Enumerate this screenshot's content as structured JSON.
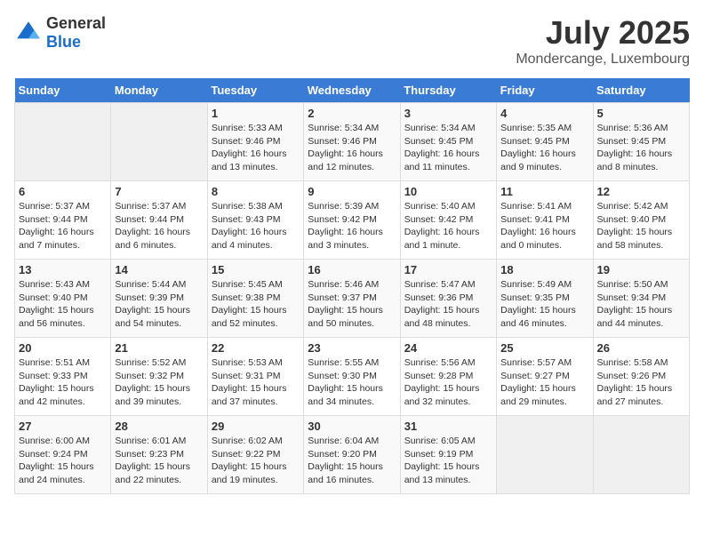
{
  "header": {
    "logo_general": "General",
    "logo_blue": "Blue",
    "month": "July 2025",
    "location": "Mondercange, Luxembourg"
  },
  "days_of_week": [
    "Sunday",
    "Monday",
    "Tuesday",
    "Wednesday",
    "Thursday",
    "Friday",
    "Saturday"
  ],
  "weeks": [
    [
      {
        "day": "",
        "empty": true
      },
      {
        "day": "",
        "empty": true
      },
      {
        "day": "1",
        "sunrise": "Sunrise: 5:33 AM",
        "sunset": "Sunset: 9:46 PM",
        "daylight": "Daylight: 16 hours and 13 minutes."
      },
      {
        "day": "2",
        "sunrise": "Sunrise: 5:34 AM",
        "sunset": "Sunset: 9:46 PM",
        "daylight": "Daylight: 16 hours and 12 minutes."
      },
      {
        "day": "3",
        "sunrise": "Sunrise: 5:34 AM",
        "sunset": "Sunset: 9:45 PM",
        "daylight": "Daylight: 16 hours and 11 minutes."
      },
      {
        "day": "4",
        "sunrise": "Sunrise: 5:35 AM",
        "sunset": "Sunset: 9:45 PM",
        "daylight": "Daylight: 16 hours and 9 minutes."
      },
      {
        "day": "5",
        "sunrise": "Sunrise: 5:36 AM",
        "sunset": "Sunset: 9:45 PM",
        "daylight": "Daylight: 16 hours and 8 minutes."
      }
    ],
    [
      {
        "day": "6",
        "sunrise": "Sunrise: 5:37 AM",
        "sunset": "Sunset: 9:44 PM",
        "daylight": "Daylight: 16 hours and 7 minutes."
      },
      {
        "day": "7",
        "sunrise": "Sunrise: 5:37 AM",
        "sunset": "Sunset: 9:44 PM",
        "daylight": "Daylight: 16 hours and 6 minutes."
      },
      {
        "day": "8",
        "sunrise": "Sunrise: 5:38 AM",
        "sunset": "Sunset: 9:43 PM",
        "daylight": "Daylight: 16 hours and 4 minutes."
      },
      {
        "day": "9",
        "sunrise": "Sunrise: 5:39 AM",
        "sunset": "Sunset: 9:42 PM",
        "daylight": "Daylight: 16 hours and 3 minutes."
      },
      {
        "day": "10",
        "sunrise": "Sunrise: 5:40 AM",
        "sunset": "Sunset: 9:42 PM",
        "daylight": "Daylight: 16 hours and 1 minute."
      },
      {
        "day": "11",
        "sunrise": "Sunrise: 5:41 AM",
        "sunset": "Sunset: 9:41 PM",
        "daylight": "Daylight: 16 hours and 0 minutes."
      },
      {
        "day": "12",
        "sunrise": "Sunrise: 5:42 AM",
        "sunset": "Sunset: 9:40 PM",
        "daylight": "Daylight: 15 hours and 58 minutes."
      }
    ],
    [
      {
        "day": "13",
        "sunrise": "Sunrise: 5:43 AM",
        "sunset": "Sunset: 9:40 PM",
        "daylight": "Daylight: 15 hours and 56 minutes."
      },
      {
        "day": "14",
        "sunrise": "Sunrise: 5:44 AM",
        "sunset": "Sunset: 9:39 PM",
        "daylight": "Daylight: 15 hours and 54 minutes."
      },
      {
        "day": "15",
        "sunrise": "Sunrise: 5:45 AM",
        "sunset": "Sunset: 9:38 PM",
        "daylight": "Daylight: 15 hours and 52 minutes."
      },
      {
        "day": "16",
        "sunrise": "Sunrise: 5:46 AM",
        "sunset": "Sunset: 9:37 PM",
        "daylight": "Daylight: 15 hours and 50 minutes."
      },
      {
        "day": "17",
        "sunrise": "Sunrise: 5:47 AM",
        "sunset": "Sunset: 9:36 PM",
        "daylight": "Daylight: 15 hours and 48 minutes."
      },
      {
        "day": "18",
        "sunrise": "Sunrise: 5:49 AM",
        "sunset": "Sunset: 9:35 PM",
        "daylight": "Daylight: 15 hours and 46 minutes."
      },
      {
        "day": "19",
        "sunrise": "Sunrise: 5:50 AM",
        "sunset": "Sunset: 9:34 PM",
        "daylight": "Daylight: 15 hours and 44 minutes."
      }
    ],
    [
      {
        "day": "20",
        "sunrise": "Sunrise: 5:51 AM",
        "sunset": "Sunset: 9:33 PM",
        "daylight": "Daylight: 15 hours and 42 minutes."
      },
      {
        "day": "21",
        "sunrise": "Sunrise: 5:52 AM",
        "sunset": "Sunset: 9:32 PM",
        "daylight": "Daylight: 15 hours and 39 minutes."
      },
      {
        "day": "22",
        "sunrise": "Sunrise: 5:53 AM",
        "sunset": "Sunset: 9:31 PM",
        "daylight": "Daylight: 15 hours and 37 minutes."
      },
      {
        "day": "23",
        "sunrise": "Sunrise: 5:55 AM",
        "sunset": "Sunset: 9:30 PM",
        "daylight": "Daylight: 15 hours and 34 minutes."
      },
      {
        "day": "24",
        "sunrise": "Sunrise: 5:56 AM",
        "sunset": "Sunset: 9:28 PM",
        "daylight": "Daylight: 15 hours and 32 minutes."
      },
      {
        "day": "25",
        "sunrise": "Sunrise: 5:57 AM",
        "sunset": "Sunset: 9:27 PM",
        "daylight": "Daylight: 15 hours and 29 minutes."
      },
      {
        "day": "26",
        "sunrise": "Sunrise: 5:58 AM",
        "sunset": "Sunset: 9:26 PM",
        "daylight": "Daylight: 15 hours and 27 minutes."
      }
    ],
    [
      {
        "day": "27",
        "sunrise": "Sunrise: 6:00 AM",
        "sunset": "Sunset: 9:24 PM",
        "daylight": "Daylight: 15 hours and 24 minutes."
      },
      {
        "day": "28",
        "sunrise": "Sunrise: 6:01 AM",
        "sunset": "Sunset: 9:23 PM",
        "daylight": "Daylight: 15 hours and 22 minutes."
      },
      {
        "day": "29",
        "sunrise": "Sunrise: 6:02 AM",
        "sunset": "Sunset: 9:22 PM",
        "daylight": "Daylight: 15 hours and 19 minutes."
      },
      {
        "day": "30",
        "sunrise": "Sunrise: 6:04 AM",
        "sunset": "Sunset: 9:20 PM",
        "daylight": "Daylight: 15 hours and 16 minutes."
      },
      {
        "day": "31",
        "sunrise": "Sunrise: 6:05 AM",
        "sunset": "Sunset: 9:19 PM",
        "daylight": "Daylight: 15 hours and 13 minutes."
      },
      {
        "day": "",
        "empty": true
      },
      {
        "day": "",
        "empty": true
      }
    ]
  ]
}
